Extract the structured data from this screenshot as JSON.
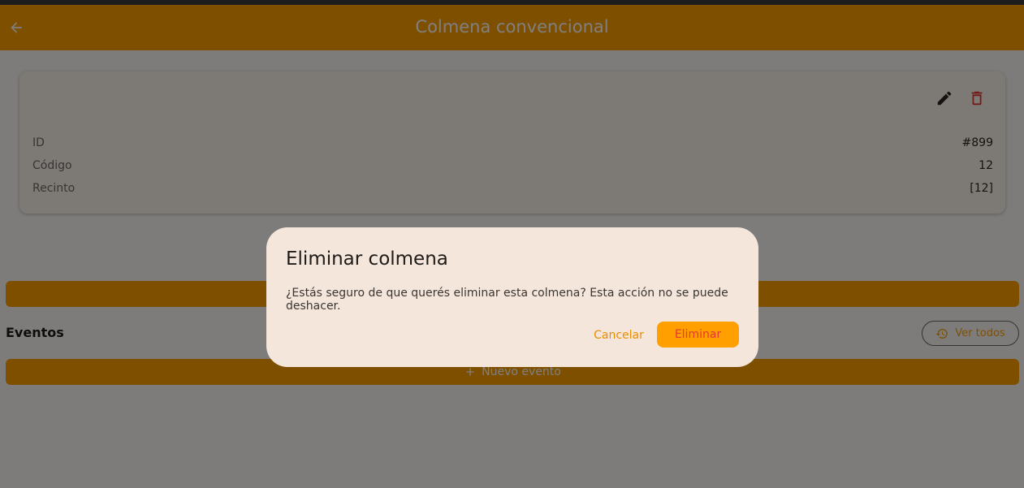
{
  "app_bar": {
    "title": "Colmena convencional",
    "back_icon": "arrow-left-icon",
    "color": "#ff9f00"
  },
  "card": {
    "actions": {
      "edit_icon": "pencil-icon",
      "delete_icon": "trash-icon"
    },
    "fields": [
      {
        "label": "ID",
        "value": "#899"
      },
      {
        "label": "Código",
        "value": "12"
      },
      {
        "label": "Recinto",
        "value": "[12]"
      }
    ]
  },
  "events": {
    "title": "Eventos",
    "view_all_label": "Ver todos",
    "view_all_icon": "history-icon",
    "new_event_label": "Nuevo evento",
    "new_event_icon": "plus-icon"
  },
  "dialog": {
    "title": "Eliminar colmena",
    "message": "¿Estás seguro de que querés eliminar esta colmena? Esta acción no se puede deshacer.",
    "cancel_label": "Cancelar",
    "confirm_label": "Eliminar",
    "destructive_color": "#e53935"
  }
}
